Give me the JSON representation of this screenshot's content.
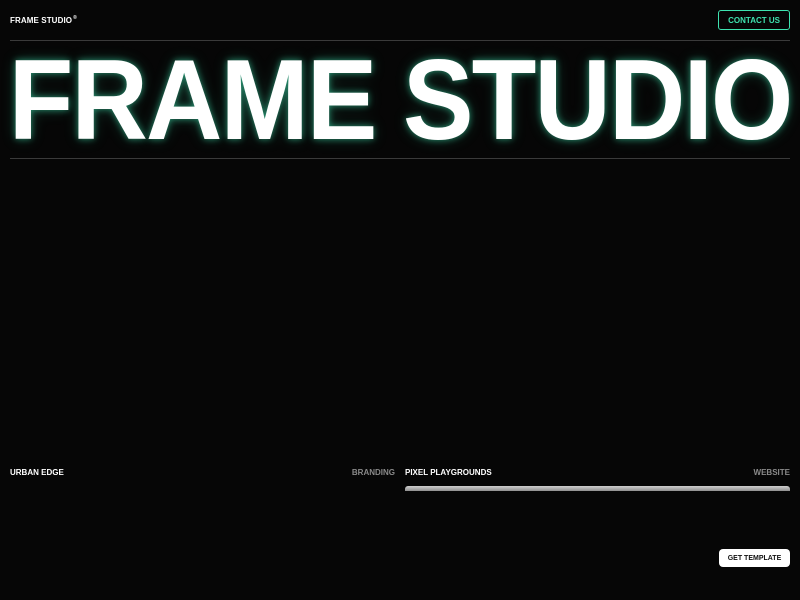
{
  "header": {
    "logo_text": "FRAME STUDIO",
    "logo_mark": "®",
    "contact_label": "CONTACT US"
  },
  "hero": {
    "title": "FRAME STUDIO"
  },
  "projects": [
    {
      "name": "URBAN EDGE",
      "category": "BRANDING"
    },
    {
      "name": "PIXEL PLAYGROUNDS",
      "category": "WEBSITE"
    }
  ],
  "cta": {
    "get_template_label": "GET TEMPLATE"
  },
  "colors": {
    "background": "#060606",
    "accent": "#3ee3b0",
    "text": "#ffffff",
    "muted": "#8a8a8a"
  }
}
